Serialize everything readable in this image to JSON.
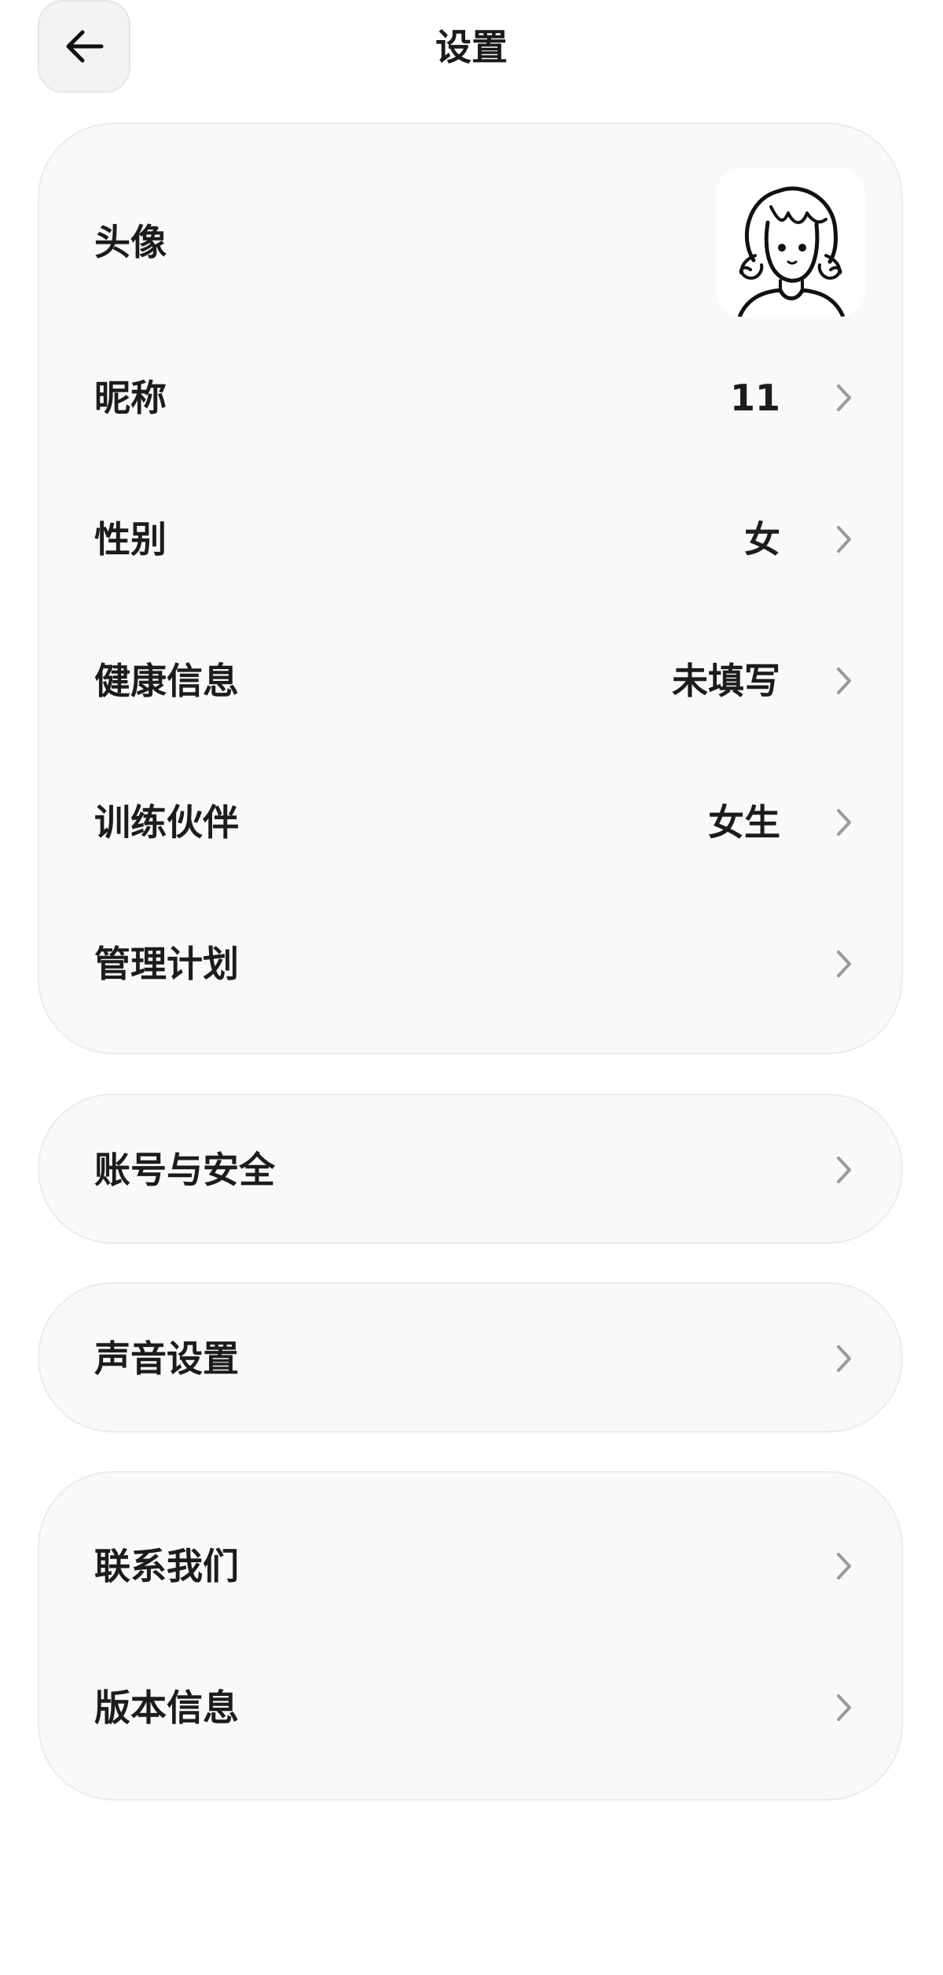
{
  "header": {
    "title": "设置",
    "back_icon": "arrow-left-icon"
  },
  "profile_card": {
    "avatar_label": "头像",
    "nickname_label": "昵称",
    "nickname_value": "11",
    "gender_label": "性别",
    "gender_value": "女",
    "health_label": "健康信息",
    "health_value": "未填写",
    "partner_label": "训练伙伴",
    "partner_value": "女生",
    "plan_label": "管理计划"
  },
  "account": {
    "label": "账号与安全"
  },
  "sound": {
    "label": "声音设置"
  },
  "about_card": {
    "contact_label": "联系我们",
    "version_label": "版本信息"
  },
  "colors": {
    "card_bg": "#f9f9f9",
    "card_border": "#ececec",
    "chevron": "#9a9a9a",
    "text": "#1c1c1c"
  }
}
